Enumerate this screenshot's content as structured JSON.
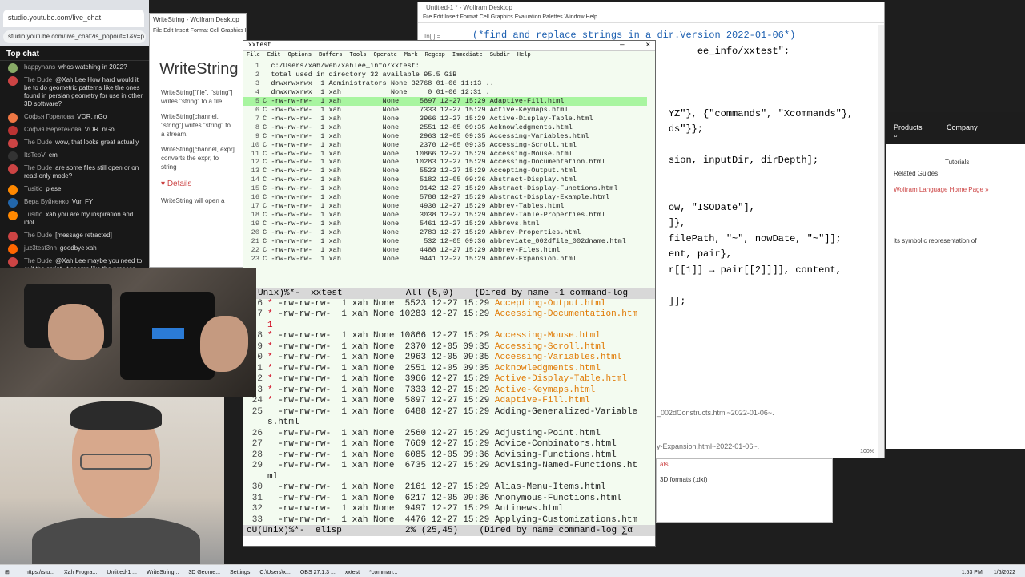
{
  "browser": {
    "tab_title": "studio.youtube.com/live_chat",
    "address": "studio.youtube.com/live_chat?is_popout=1&v=p"
  },
  "chat": {
    "header": "Top chat",
    "messages": [
      {
        "author": "happynans",
        "text": "whos watching in 2022?",
        "color": "#8a6"
      },
      {
        "author": "The Dude",
        "text": "@Xah Lee How hard would it be to do geometric patterns like the ones found in persian geometry for use in other 3D software?",
        "color": "#c44"
      },
      {
        "author": "Софья Горелова",
        "text": "VOR. nGo",
        "color": "#e74"
      },
      {
        "author": "София Веретенова",
        "text": "VOR. nGo",
        "color": "#b33"
      },
      {
        "author": "The Dude",
        "text": "wow, that looks great actually",
        "color": "#c44"
      },
      {
        "author": "ItsTeoV",
        "text": "em",
        "color": "#333"
      },
      {
        "author": "The Dude",
        "text": "are some files still open or on read-only mode?",
        "color": "#c44"
      },
      {
        "author": "Tusitio",
        "text": "plese",
        "color": "#f80"
      },
      {
        "author": "Вера Буйненко",
        "text": "Vur. FY",
        "color": "#26a"
      },
      {
        "author": "Tusitio",
        "text": "xah you are my inspiration and idol",
        "color": "#f80"
      },
      {
        "author": "The Dude",
        "text": "[message retracted]",
        "color": "#c44"
      },
      {
        "author": "juz3test3nn",
        "text": "goodbye xah",
        "color": "#f60"
      },
      {
        "author": "The Dude",
        "text": "@Xah Lee maybe you need to exit the script. it seems like the process holds onto the files",
        "color": "#c44"
      }
    ]
  },
  "wolfram_doc": {
    "window_title": "WriteString - Wolfram Desktop",
    "menu": "File Edit Insert Format Cell Graphics Evaluation Palettes Window Help",
    "heading": "WriteString",
    "desc1": "WriteString[\"file\", \"string\"] writes \"string\" to a file.",
    "desc2": "WriteString[channel, \"string\"] writes \"string\" to a stream.",
    "desc3": "WriteString[channel, expr] converts the expr, to string",
    "details": "Details",
    "bullet": "WriteString will open a"
  },
  "notebook": {
    "window_title": "Untitled-1 * - Wolfram Desktop",
    "menu": "File Edit Insert Format Cell Graphics Evaluation Palettes Window Help",
    "prompt": "In[ ]:=",
    "lines": [
      "(*find and replace strings in a dir.Version 2022-01-06*)",
      "                                       ee_info/xxtest\";",
      "",
      "",
      "",
      "                                  YZ\"}, {\"commands\", \"Xcommands\"},",
      "                                  ds\"}};",
      "",
      "                                  sion, inputDir, dirDepth];",
      "",
      "",
      "                                  ow, \"ISODate\"],",
      "                                  ]},",
      "                                  filePath, \"~\", nowDate, \"~\"]];",
      "                                  ent, pair},",
      "                                  r[[1]] → pair[[2]]]], content,",
      "",
      "                                  ]];"
    ],
    "zoom": "100%"
  },
  "wolfram_side": {
    "nav": [
      "Products",
      "Company"
    ],
    "items": [
      "Related Guides",
      "Tutorials",
      "Wolfram Language Home Page »",
      "its symbolic representation of"
    ]
  },
  "emacs": {
    "window_title": "xxtest",
    "menu": [
      "File",
      "Edit",
      "Options",
      "Buffers",
      "Tools",
      "Operate",
      "Mark",
      "Regexp",
      "Immediate",
      "Subdir",
      "Help"
    ],
    "top_lines": [
      {
        "n": "1",
        "t": "  c:/Users/xah/web/xahlee_info/xxtest:"
      },
      {
        "n": "2",
        "t": "  total used in directory 32 available 95.5 GiB"
      },
      {
        "n": "3",
        "t": "  drwxrwxrwx  1 Administrators None 32768 01-06 11:13 .."
      },
      {
        "n": "4",
        "t": "  drwxrwxrwx  1 xah            None     0 01-06 12:31 ."
      },
      {
        "n": "5",
        "t": "C -rw-rw-rw-  1 xah          None     5897 12-27 15:29 Adaptive-Fill.html",
        "hl": true
      },
      {
        "n": "6",
        "t": "C -rw-rw-rw-  1 xah          None     7333 12-27 15:29 Active-Keymaps.html"
      },
      {
        "n": "7",
        "t": "C -rw-rw-rw-  1 xah          None     3966 12-27 15:29 Active-Display-Table.html"
      },
      {
        "n": "8",
        "t": "C -rw-rw-rw-  1 xah          None     2551 12-05 09:35 Acknowledgments.html"
      },
      {
        "n": "9",
        "t": "C -rw-rw-rw-  1 xah          None     2963 12-05 09:35 Accessing-Variables.html"
      },
      {
        "n": "10",
        "t": "C -rw-rw-rw-  1 xah          None     2370 12-05 09:35 Accessing-Scroll.html"
      },
      {
        "n": "11",
        "t": "C -rw-rw-rw-  1 xah          None    10866 12-27 15:29 Accessing-Mouse.html"
      },
      {
        "n": "12",
        "t": "C -rw-rw-rw-  1 xah          None    10283 12-27 15:29 Accessing-Documentation.html"
      },
      {
        "n": "13",
        "t": "C -rw-rw-rw-  1 xah          None     5523 12-27 15:29 Accepting-Output.html"
      },
      {
        "n": "14",
        "t": "C -rw-rw-rw-  1 xah          None     5182 12-05 09:36 Abstract-Display.html"
      },
      {
        "n": "15",
        "t": "C -rw-rw-rw-  1 xah          None     9142 12-27 15:29 Abstract-Display-Functions.html"
      },
      {
        "n": "16",
        "t": "C -rw-rw-rw-  1 xah          None     5788 12-27 15:29 Abstract-Display-Example.html"
      },
      {
        "n": "17",
        "t": "C -rw-rw-rw-  1 xah          None     4930 12-27 15:29 Abbrev-Tables.html"
      },
      {
        "n": "18",
        "t": "C -rw-rw-rw-  1 xah          None     3038 12-27 15:29 Abbrev-Table-Properties.html"
      },
      {
        "n": "19",
        "t": "C -rw-rw-rw-  1 xah          None     5461 12-27 15:29 Abbrevs.html"
      },
      {
        "n": "20",
        "t": "C -rw-rw-rw-  1 xah          None     2783 12-27 15:29 Abbrev-Properties.html"
      },
      {
        "n": "21",
        "t": "C -rw-rw-rw-  1 xah          None      532 12-05 09:36 abbreviate_002dfile_002dname.html"
      },
      {
        "n": "22",
        "t": "C -rw-rw-rw-  1 xah          None     4488 12-27 15:29 Abbrev-Files.html"
      },
      {
        "n": "23",
        "t": "C -rw-rw-rw-  1 xah          None     9441 12-27 15:29 Abbrev-Expansion.html"
      }
    ],
    "mode_line_1": "Unix)%*-  xxtest            All (5,0)    (Dired by name -1 command-log",
    "bottom_lines": [
      {
        "n": "6",
        "m": "*",
        "meta": " -rw-rw-rw-  1 xah None  5523 12-27 15:29 ",
        "f": "Accepting-Output.html",
        "marked": true
      },
      {
        "n": "7",
        "m": "*",
        "meta": " -rw-rw-rw-  1 xah None 10283 12-27 15:29 ",
        "f": "Accessing-Documentation.htm",
        "marked": true
      },
      {
        "n": "",
        "m": "",
        "meta": "1",
        "f": "",
        "marked": true
      },
      {
        "n": "8",
        "m": "*",
        "meta": " -rw-rw-rw-  1 xah None 10866 12-27 15:29 ",
        "f": "Accessing-Mouse.html",
        "marked": true
      },
      {
        "n": "9",
        "m": "*",
        "meta": " -rw-rw-rw-  1 xah None  2370 12-05 09:35 ",
        "f": "Accessing-Scroll.html",
        "marked": true
      },
      {
        "n": "0",
        "m": "*",
        "meta": " -rw-rw-rw-  1 xah None  2963 12-05 09:35 ",
        "f": "Accessing-Variables.html",
        "marked": true
      },
      {
        "n": "1",
        "m": "*",
        "meta": " -rw-rw-rw-  1 xah None  2551 12-05 09:35 ",
        "f": "Acknowledgments.html",
        "marked": true
      },
      {
        "n": "2",
        "m": "*",
        "meta": " -rw-rw-rw-  1 xah None  3966 12-27 15:29 ",
        "f": "Active-Display-Table.html",
        "marked": true
      },
      {
        "n": "3",
        "m": "*",
        "meta": " -rw-rw-rw-  1 xah None  7333 12-27 15:29 ",
        "f": "Active-Keymaps.html",
        "marked": true
      },
      {
        "n": "24",
        "m": "*",
        "meta": " -rw-rw-rw-  1 xah None  5897 12-27 15:29 ",
        "f": "Adaptive-Fill.html",
        "marked": true
      },
      {
        "n": "25",
        "m": " ",
        "meta": " -rw-rw-rw-  1 xah None  6488 12-27 15:29 ",
        "f": "Adding-Generalized-Variable",
        "marked": false
      },
      {
        "n": "",
        "m": "",
        "meta": "s.html",
        "f": "",
        "marked": false
      },
      {
        "n": "26",
        "m": " ",
        "meta": " -rw-rw-rw-  1 xah None  2560 12-27 15:29 ",
        "f": "Adjusting-Point.html",
        "marked": false
      },
      {
        "n": "27",
        "m": " ",
        "meta": " -rw-rw-rw-  1 xah None  7669 12-27 15:29 ",
        "f": "Advice-Combinators.html",
        "marked": false
      },
      {
        "n": "28",
        "m": " ",
        "meta": " -rw-rw-rw-  1 xah None  6085 12-05 09:36 ",
        "f": "Advising-Functions.html",
        "marked": false
      },
      {
        "n": "29",
        "m": " ",
        "meta": " -rw-rw-rw-  1 xah None  6735 12-27 15:29 ",
        "f": "Advising-Named-Functions.ht",
        "marked": false
      },
      {
        "n": "",
        "m": "",
        "meta": "ml",
        "f": "",
        "marked": false
      },
      {
        "n": "30",
        "m": " ",
        "meta": " -rw-rw-rw-  1 xah None  2161 12-27 15:29 ",
        "f": "Alias-Menu-Items.html",
        "marked": false
      },
      {
        "n": "31",
        "m": " ",
        "meta": " -rw-rw-rw-  1 xah None  6217 12-05 09:36 ",
        "f": "Anonymous-Functions.html",
        "marked": false
      },
      {
        "n": "32",
        "m": " ",
        "meta": " -rw-rw-rw-  1 xah None  9497 12-27 15:29 ",
        "f": "Antinews.html",
        "marked": false
      },
      {
        "n": "33",
        "m": " ",
        "meta": " -rw-rw-rw-  1 xah None  4476 12-27 15:29 ",
        "f": "Applying-Customizations.htm",
        "marked": false
      }
    ],
    "mode_line_2": "cU(Unix)%*-  elisp            2% (25,45)    (Dired by name command-log ∑α"
  },
  "background_texts": {
    "frag1": "_002dConstructs.html~2022-01-06~.",
    "frag2": "y-Expansion.html~2022-01-06~.",
    "frag3": "3D formats (.dxf)",
    "frag4": "ats"
  },
  "taskbar": {
    "items": [
      "https://stu...",
      "Xah Progra...",
      "Untitled-1 ...",
      "WriteString...",
      "3D Geome...",
      "Settings",
      "C:\\Users\\x...",
      "OBS 27.1.3 ...",
      "xxtest",
      "*comman..."
    ],
    "time": "1:53 PM",
    "date": "1/6/2022"
  },
  "colors": {
    "emacs_bg": "#f3fbf0",
    "dired_marked": "#d0001a",
    "dired_marked_file": "#e07800",
    "highlight_line": "#a8f5a0"
  }
}
